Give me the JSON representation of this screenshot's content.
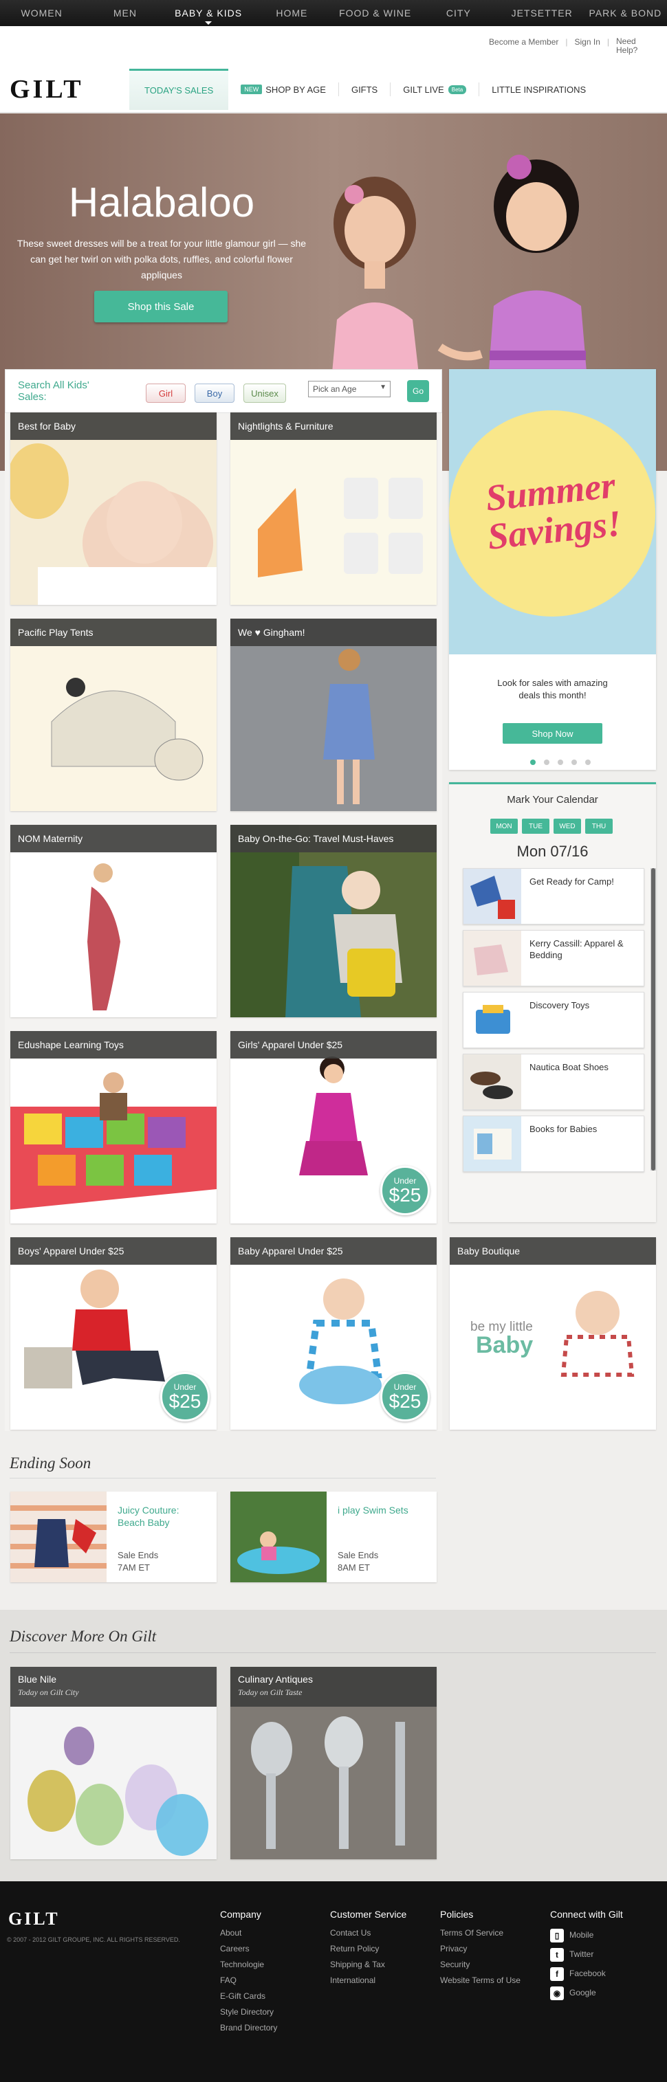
{
  "topnav": {
    "items": [
      "WOMEN",
      "MEN",
      "BABY & KIDS",
      "HOME",
      "FOOD & WINE",
      "CITY",
      "JETSETTER",
      "PARK & BOND"
    ],
    "active": 2
  },
  "header": {
    "util_links": [
      "Become a Member",
      "Sign In",
      "Need Help?"
    ],
    "logo": "GILT",
    "tabs": [
      {
        "label": "TODAY'S SALES"
      },
      {
        "label": "SHOP BY AGE",
        "badge": "NEW"
      },
      {
        "label": "GIFTS"
      },
      {
        "label": "GILT LIVE",
        "badge": "Beta"
      },
      {
        "label": "LITTLE INSPIRATIONS"
      }
    ]
  },
  "hero": {
    "title": "Halabaloo",
    "text": "These sweet dresses will be a treat for your little glamour girl — she can get her twirl on with polka dots, ruffles, and colorful flower appliques",
    "button": "Shop this Sale"
  },
  "search": {
    "label": "Search All Kids' Sales:",
    "filters": [
      "Girl",
      "Boy",
      "Unisex"
    ],
    "age_placeholder": "Pick an Age",
    "go": "Go"
  },
  "sales": [
    {
      "title": "Best for Baby"
    },
    {
      "title": "Nightlights & Furniture"
    },
    {
      "title": "Pacific Play Tents"
    },
    {
      "title": "We ♥ Gingham!"
    },
    {
      "title": "NOM Maternity"
    },
    {
      "title": "Baby On-the-Go: Travel Must-Haves"
    },
    {
      "title": "Edushape Learning Toys"
    },
    {
      "title": "Girls' Apparel Under $25",
      "badge_top": "Under",
      "badge_value": "$25"
    },
    {
      "title": "Boys' Apparel Under $25",
      "badge_top": "Under",
      "badge_value": "$25"
    },
    {
      "title": "Baby Apparel Under $25",
      "badge_top": "Under",
      "badge_value": "$25"
    },
    {
      "title": "Baby Boutique",
      "overlay_top": "be my little",
      "overlay_main": "Baby"
    }
  ],
  "promo": {
    "headline_1": "Summer",
    "headline_2": "Savings!",
    "text": "Look for sales with amazing deals this month!",
    "button": "Shop Now",
    "dots": 5,
    "active_dot": 0
  },
  "calendar": {
    "title": "Mark Your Calendar",
    "days": [
      "MON",
      "TUE",
      "WED",
      "THU"
    ],
    "date": "Mon 07/16",
    "items": [
      "Get Ready for Camp!",
      "Kerry Cassill: Apparel & Bedding",
      "Discovery Toys",
      "Nautica Boat Shoes",
      "Books for Babies"
    ]
  },
  "ending_soon": {
    "heading": "Ending Soon",
    "items": [
      {
        "name": "Juicy Couture: Beach Baby",
        "label": "Sale Ends",
        "time": "7AM ET"
      },
      {
        "name": "i play Swim Sets",
        "label": "Sale Ends",
        "time": "8AM ET"
      }
    ]
  },
  "discover": {
    "heading": "Discover More On Gilt",
    "items": [
      {
        "title": "Blue Nile",
        "subtitle": "Today on Gilt City"
      },
      {
        "title": "Culinary Antiques",
        "subtitle": "Today on Gilt Taste"
      }
    ]
  },
  "footer": {
    "logo": "GILT",
    "copyright": "© 2007 - 2012 GILT GROUPE, INC. ALL RIGHTS RESERVED.",
    "columns": [
      {
        "title": "Company",
        "links": [
          "About",
          "Careers",
          "Technologie",
          "FAQ",
          "E-Gift Cards",
          "Style Directory",
          "Brand Directory"
        ]
      },
      {
        "title": "Customer Service",
        "links": [
          "Contact Us",
          "Return Policy",
          "Shipping & Tax",
          "International"
        ]
      },
      {
        "title": "Policies",
        "links": [
          "Terms Of Service",
          "Privacy",
          "Security",
          "Website Terms of Use"
        ]
      }
    ],
    "connect": {
      "title": "Connect with Gilt",
      "links": [
        {
          "icon": "mobile-icon",
          "label": "Mobile"
        },
        {
          "icon": "twitter-icon",
          "label": "Twitter"
        },
        {
          "icon": "facebook-icon",
          "label": "Facebook"
        },
        {
          "icon": "google-icon",
          "label": "Google"
        }
      ]
    }
  },
  "colors": {
    "accent": "#46b898",
    "nav_bg": "#1e1e1e",
    "promo_yellow": "#f9e78a",
    "promo_pink": "#e13d6a",
    "promo_sky": "#b4dce9"
  }
}
